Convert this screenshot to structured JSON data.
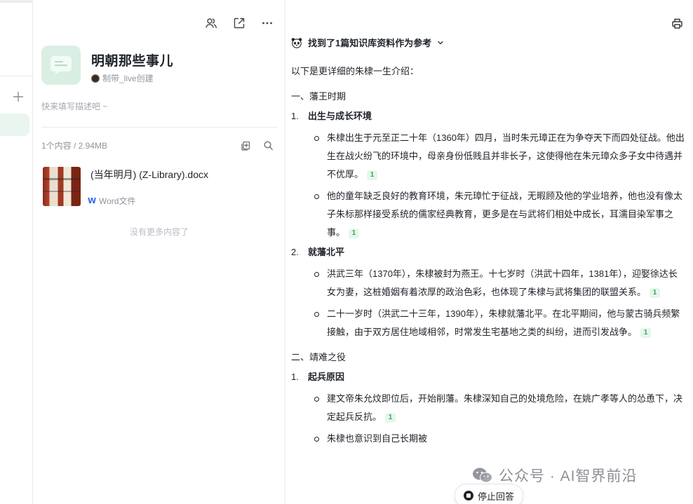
{
  "sidebar": {
    "add_icon": "plus-icon"
  },
  "knowledge_base": {
    "title": "明朝那些事儿",
    "creator": "制带_live创建",
    "description_placeholder": "快来填写描述吧 ~",
    "content_summary": "1个内容 / 2.94MB",
    "toolbar_icons": [
      "members-icon",
      "share-icon",
      "more-icon"
    ],
    "list_icons": [
      "add-file-icon",
      "search-icon"
    ],
    "files": [
      {
        "name": "(当年明月) (Z-Library).docx",
        "type": "Word文件",
        "type_badge": "W"
      }
    ],
    "no_more": "没有更多内容了"
  },
  "chat": {
    "reference_header": "找到了1篇知识库资料作为参考",
    "intro": "以下是更详细的朱棣一生介绍：",
    "sections": [
      {
        "heading": "一、藩王时期",
        "items": [
          {
            "num": "1.",
            "title": "出生与成长环境",
            "bullets": [
              {
                "text": "朱棣出生于元至正二十年（1360年）四月，当时朱元璋正在为争夺天下而四处征战。他出生在战火纷飞的环境中，母亲身份低贱且并非长子，这使得他在朱元璋众多子女中待遇并不优厚。",
                "cite": "1"
              },
              {
                "text": "他的童年缺乏良好的教育环境，朱元璋忙于征战，无暇顾及他的学业培养，他也没有像太子朱标那样接受系统的儒家经典教育，更多是在与武将们相处中成长，耳濡目染军事之事。",
                "cite": "1"
              }
            ]
          },
          {
            "num": "2.",
            "title": "就藩北平",
            "bullets": [
              {
                "text": "洪武三年（1370年），朱棣被封为燕王。十七岁时（洪武十四年，1381年），迎娶徐达长女为妻，这桩婚姻有着浓厚的政治色彩，也体现了朱棣与武将集团的联盟关系。",
                "cite": "1"
              },
              {
                "text": "二十一岁时（洪武二十三年，1390年），朱棣就藩北平。在北平期间，他与蒙古骑兵频繁接触，由于双方居住地域相邻，时常发生宅基地之类的纠纷，进而引发战争。",
                "cite": "1"
              }
            ]
          }
        ]
      },
      {
        "heading": "二、靖难之役",
        "items": [
          {
            "num": "1.",
            "title": "起兵原因",
            "bullets": [
              {
                "text": "建文帝朱允炆即位后，开始削藩。朱棣深知自己的处境危险，在姚广孝等人的怂恿下，决定起兵反抗。",
                "cite": "1"
              },
              {
                "text": "朱棣也意识到自己长期被",
                "cite": ""
              }
            ]
          }
        ]
      }
    ],
    "stop_button": "停止回答",
    "print_icon": "printer-icon"
  },
  "watermark": {
    "text": "公众号 · AI智界前沿"
  }
}
